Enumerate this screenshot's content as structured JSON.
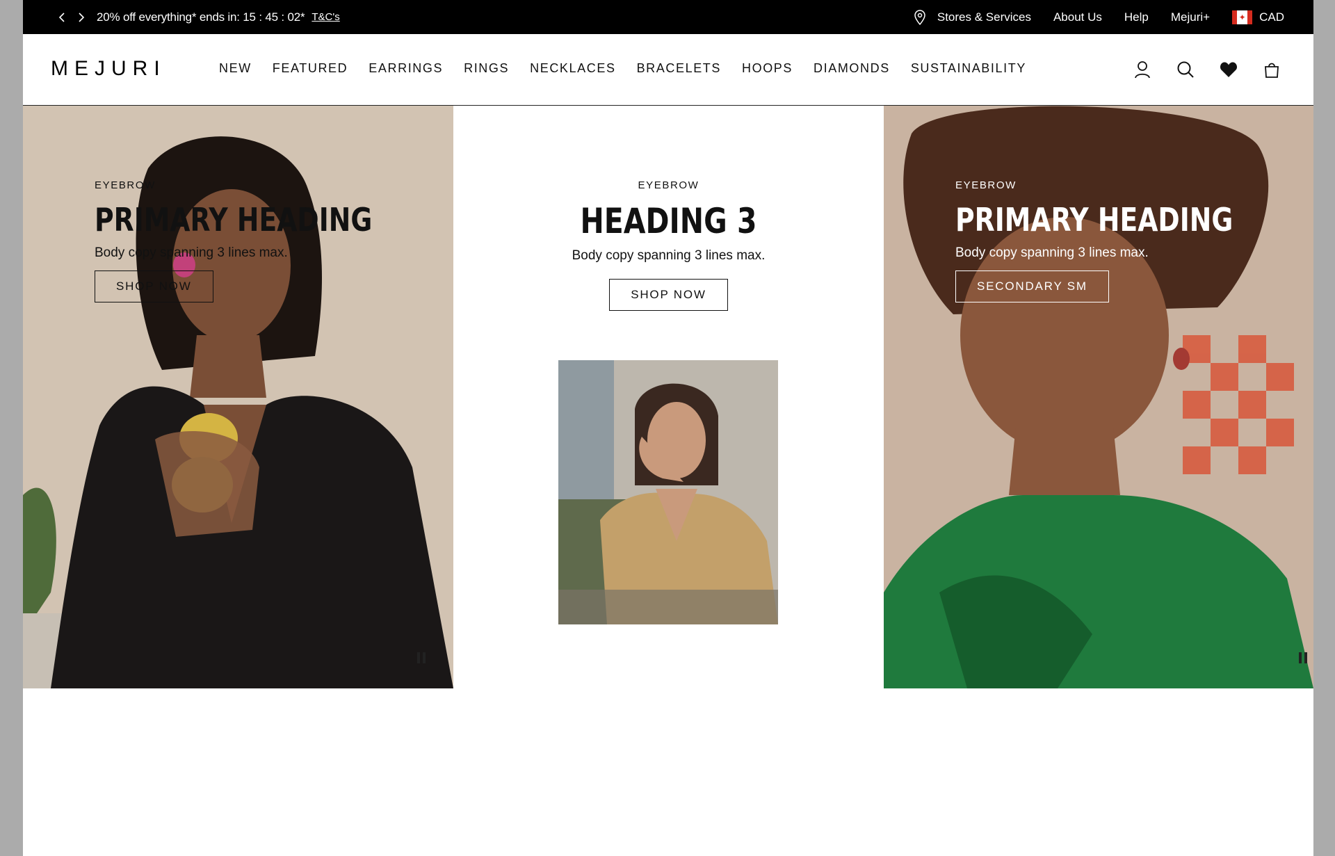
{
  "announcement": {
    "prev_label": "‹",
    "next_label": "›",
    "promo_text": "20% off everything* ends in: 15 : 45 : 02*",
    "tnc_label": "T&C's",
    "links": [
      "Stores & Services",
      "About Us",
      "Help",
      "Mejuri+"
    ],
    "currency": "CAD"
  },
  "header": {
    "logo": "MEJURI",
    "nav": [
      "NEW",
      "FEATURED",
      "EARRINGS",
      "RINGS",
      "NECKLACES",
      "BRACELETS",
      "HOOPS",
      "DIAMONDS",
      "SUSTAINABILITY"
    ],
    "icons": [
      "account-icon",
      "search-icon",
      "heart-icon",
      "bag-icon"
    ]
  },
  "hero": {
    "left": {
      "eyebrow": "EYEBROW",
      "heading": "PRIMARY HEADING",
      "body": "Body copy spanning 3 lines max.",
      "button": "SHOP NOW"
    },
    "center": {
      "eyebrow": "EYEBROW",
      "heading": "HEADING 3",
      "body": "Body copy spanning 3 lines max.",
      "button": "SHOP NOW"
    },
    "right": {
      "eyebrow": "EYEBROW",
      "heading": "PRIMARY HEADING",
      "body": "Body copy spanning 3 lines max.",
      "button": "SECONDARY SM"
    }
  },
  "colors": {
    "topbar_bg": "#000000",
    "page_bg": "#ffffff",
    "outer_bg": "#ababab"
  }
}
